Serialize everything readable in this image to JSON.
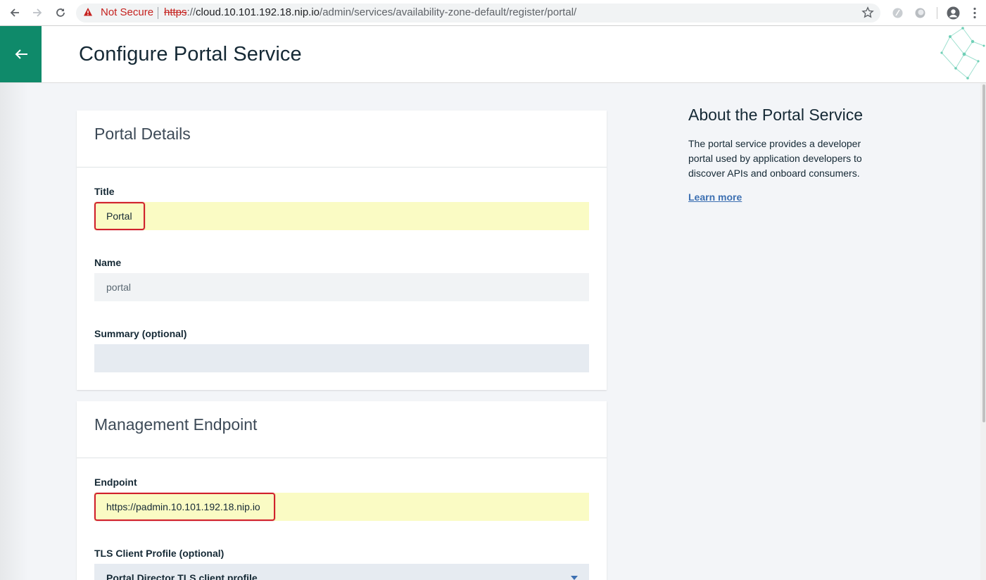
{
  "browser": {
    "security_label": "Not Secure",
    "url_scheme": "https",
    "url_sep": "://",
    "url_host": "cloud.10.101.192.18.nip.io",
    "url_path": "/admin/services/availability-zone-default/register/portal/"
  },
  "header": {
    "title": "Configure Portal Service",
    "accent_color": "#0f8a6a"
  },
  "portal_details": {
    "heading": "Portal Details",
    "title_label": "Title",
    "title_value": "Portal",
    "name_label": "Name",
    "name_value": "portal",
    "summary_label": "Summary (optional)",
    "summary_value": ""
  },
  "management_endpoint": {
    "heading": "Management Endpoint",
    "endpoint_label": "Endpoint",
    "endpoint_value": "https://padmin.10.101.192.18.nip.io",
    "tls_label": "TLS Client Profile (optional)",
    "tls_value": "Portal Director TLS client profile"
  },
  "about": {
    "title": "About the Portal Service",
    "description": "The portal service provides a developer portal used by application developers to discover APIs and onboard consumers.",
    "link": "Learn more"
  }
}
